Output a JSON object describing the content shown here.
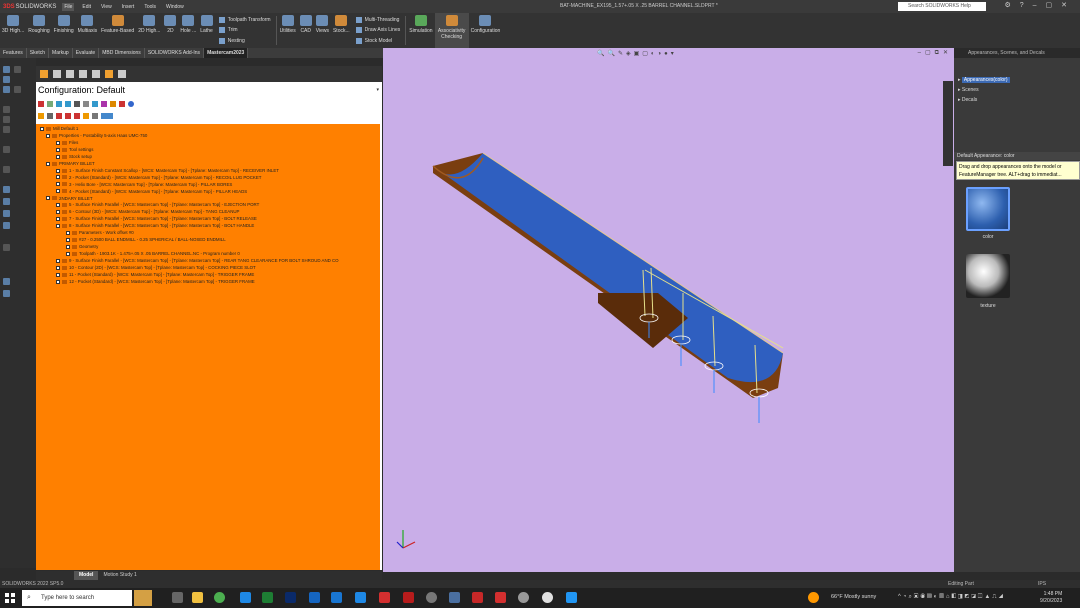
{
  "app": {
    "logo": "SOLIDWORKS",
    "document_title": "BAT-MACHINE_EX195_1.57+.05 X .25 BARREL CHANNEL.SLDPRT *",
    "menu": [
      "File",
      "Edit",
      "View",
      "Insert",
      "Tools",
      "Window"
    ],
    "help_search_placeholder": "Search SOLIDWORKS Help"
  },
  "ribbon": {
    "buttons": [
      "3D High...",
      "Roughing",
      "Finishing",
      "Multiaxis",
      "Feature-Based",
      "2D High...",
      "2D",
      "Hole ...",
      "Lathe"
    ],
    "group1": [
      "Toolpath Transform",
      "Trim",
      "Nesting"
    ],
    "buttons2": [
      "Utilities",
      "CAD",
      "Views",
      "Stock..."
    ],
    "group2": [
      "Multi-Threading",
      "Draw Axis Lines",
      "Stock Model"
    ],
    "simulation": "Simulation",
    "associativity": "Associativity Checking",
    "configuration": "Configuration"
  },
  "tabs": [
    "Features",
    "Sketch",
    "Markup",
    "Evaluate",
    "MBD Dimensions",
    "SOLIDWORKS Add-Ins",
    "Mastercam2023"
  ],
  "active_tab": "Mastercam2023",
  "feature_manager": {
    "config_title": "Configuration:  Default",
    "tree": [
      {
        "level": 0,
        "text": "Mill Default 1"
      },
      {
        "level": 1,
        "text": "Properties - Postability 5-axis Haas UMC-750"
      },
      {
        "level": 2,
        "text": "Files"
      },
      {
        "level": 2,
        "text": "Tool settings"
      },
      {
        "level": 2,
        "text": "Stock setup"
      },
      {
        "level": 1,
        "text": "PRIMARY BILLET"
      },
      {
        "level": 2,
        "text": "1 - Surface Finish Constant Scallop - [WCS: Mastercam Top] - [Tplane: Mastercam Top] - RECEIVER INLET"
      },
      {
        "level": 2,
        "text": "2 - Pocket (Standard) - [WCS: Mastercam Top] - [Tplane: Mastercam Top] - RECOIL LUG POCKET"
      },
      {
        "level": 2,
        "text": "3 - Helix Bore - [WCS: Mastercam Top] - [Tplane: Mastercam Top] - PILLAR BORES"
      },
      {
        "level": 2,
        "text": "4 - Pocket (Standard) - [WCS: Mastercam Top] - [Tplane: Mastercam Top] - PILLAR HEADS"
      },
      {
        "level": 1,
        "text": "2NDARY BILLET"
      },
      {
        "level": 2,
        "text": "5 - Surface Finish Parallel - [WCS: Mastercam Top] - [Tplane: Mastercam Top] - EJECTION PORT"
      },
      {
        "level": 2,
        "text": "6 - Contour (3D) - [WCS: Mastercam Top] - [Tplane: Mastercam Top] - TANG CLEANUP"
      },
      {
        "level": 2,
        "text": "7 - Surface Finish Parallel - [WCS: Mastercam Top] - [Tplane: Mastercam Top] - BOLT RELEASE"
      },
      {
        "level": 2,
        "text": "8 - Surface Finish Parallel - [WCS: Mastercam Top] - [Tplane: Mastercam Top] - BOLT HANDLE"
      },
      {
        "level": 3,
        "text": "Parameters - Work offset #0"
      },
      {
        "level": 3,
        "text": "#27 - 0.2500 BALL ENDMILL - 0.25 SPHERICAL / BALL-NOSED ENDMILL"
      },
      {
        "level": 3,
        "text": "Geometry"
      },
      {
        "level": 3,
        "text": "Toolpath - 1903.1K - 1.475+.05 X .05 BARREL CHANNEL.NC - Program number 0"
      },
      {
        "level": 2,
        "text": "9 - Surface Finish Parallel - [WCS: Mastercam Top] - [Tplane: Mastercam Top] - REAR TANG CLEARANCE FOR BOLT SHROUD AND CO"
      },
      {
        "level": 2,
        "text": "10 - Contour (2D) - [WCS: Mastercam Top] - [Tplane: Mastercam Top] - COCKING PIECE SLOT"
      },
      {
        "level": 2,
        "text": "11 - Pocket (Standard) - [WCS: Mastercam Top] - [Tplane: Mastercam Top] - TRIGGER FRAME"
      },
      {
        "level": 2,
        "text": "12 - Pocket (Standard) - [WCS: Mastercam Top] - [Tplane: Mastercam Top] - TRIGGER FRAME"
      }
    ]
  },
  "bottom_tabs": [
    "Model",
    "Motion Study 1"
  ],
  "task_pane": {
    "header": "Appearances, Scenes, and Decals",
    "items": [
      "Appearances(color)",
      "Scenes",
      "Decals"
    ],
    "section_title": "Default Appearance: color",
    "tooltip": "Drag and drop appearances onto the model or FeatureManager tree.  ALT+drag to immediat...",
    "swatches": [
      {
        "label": "color",
        "color": "#3b6fb5"
      },
      {
        "label": "texture",
        "color": "#e0e0e0"
      }
    ]
  },
  "status": {
    "left": "SOLIDWORKS 2022 SP5.0",
    "editing": "Editing Part",
    "units": "IPS"
  },
  "taskbar": {
    "search_placeholder": "Type here to search",
    "weather": "66°F  Mostly sunny",
    "time": "1:48 PM",
    "date": "9/20/2023"
  },
  "colors": {
    "tree_bg": "#ff8000",
    "viewport_bg": "#c9aee8",
    "part_brown": "#7a3e10",
    "channel_blue": "#2f5fc0"
  }
}
